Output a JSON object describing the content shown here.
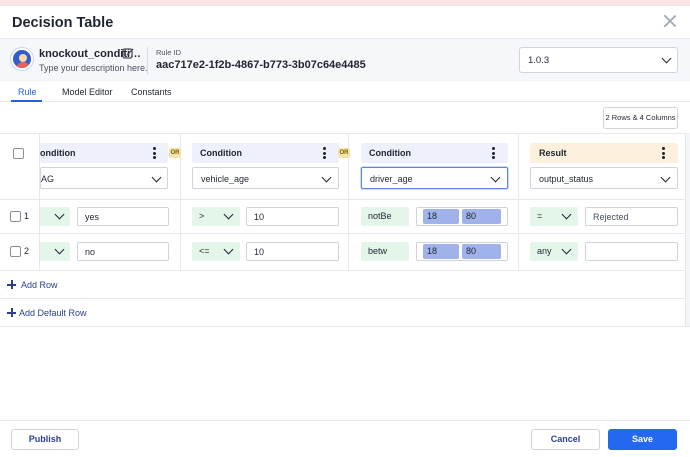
{
  "dialog": {
    "title": "Decision Table"
  },
  "rule_info": {
    "name": "knockout_conditi…",
    "description": "Type your description here.",
    "id_label": "Rule ID",
    "id": "aac717e2-1f2b-4867-b773-3b07c64e4485",
    "version": "1.0.3"
  },
  "tabs": [
    {
      "label": "Rule",
      "active": true
    },
    {
      "label": "Model Editor",
      "active": false
    },
    {
      "label": "Constants",
      "active": false
    }
  ],
  "table_summary": "2 Rows & 4 Columns",
  "connector_label": "OR",
  "columns": [
    {
      "header": "ondition",
      "field": "AG"
    },
    {
      "header": "Condition",
      "field": "vehicle_age"
    },
    {
      "header": "Condition",
      "field": "driver_age"
    },
    {
      "header": "Result",
      "field": "output_status"
    }
  ],
  "rows": [
    {
      "number": "1",
      "cells": [
        {
          "op": "",
          "value": "yes"
        },
        {
          "op": ">",
          "value": "10"
        },
        {
          "op": "notBe",
          "range": [
            "18",
            "80"
          ]
        },
        {
          "op": "=",
          "value": "Rejected"
        }
      ]
    },
    {
      "number": "2",
      "cells": [
        {
          "op": "",
          "value": "no"
        },
        {
          "op": "<=",
          "value": "10"
        },
        {
          "op": "betw",
          "range": [
            "18",
            "80"
          ]
        },
        {
          "op": "any",
          "value": ""
        }
      ]
    }
  ],
  "actions": {
    "add_row": "Add Row",
    "add_default_row": "Add Default Row"
  },
  "footer": {
    "publish": "Publish",
    "cancel": "Cancel",
    "save": "Save"
  },
  "colors": {
    "primary": "#2468f2",
    "link": "#2361d8",
    "condition_header": "#eef0fb",
    "result_header": "#fdf0dc",
    "operator_bg": "#e4f5ea",
    "range_bg": "#9fb3ea",
    "or_badge": "#f6e4a8"
  }
}
